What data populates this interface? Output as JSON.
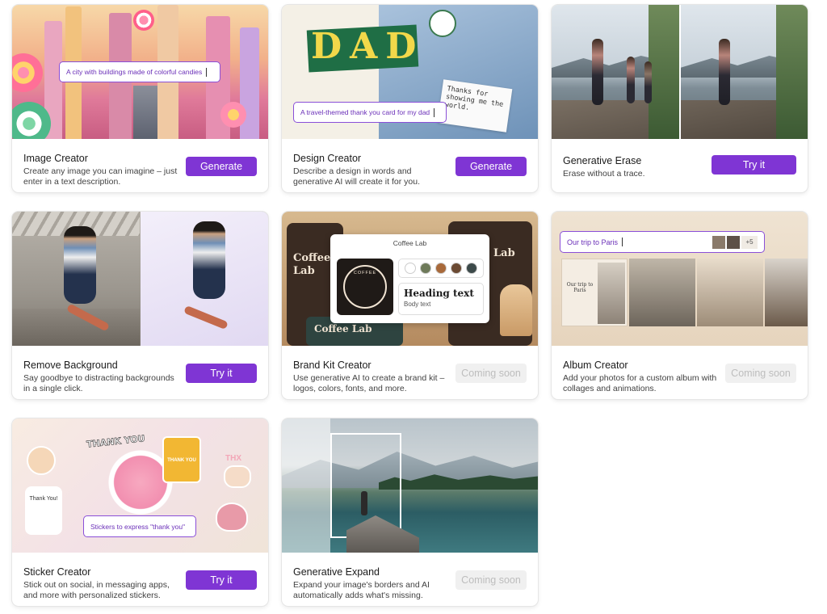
{
  "cards": [
    {
      "title": "Image Creator",
      "description": "Create any image you can imagine – just enter in a text description.",
      "action": "Generate",
      "prompt": "A city with buildings made of colorful candies"
    },
    {
      "title": "Design Creator",
      "description": "Describe a design in words and generative AI will create it for you.",
      "action": "Generate",
      "prompt": "A travel-themed thank you card for my dad",
      "art_word": "DAD",
      "note_text": "Thanks for showing me the world."
    },
    {
      "title": "Generative Erase",
      "description": "Erase without a trace.",
      "action": "Try it"
    },
    {
      "title": "Remove Background",
      "description": "Say goodbye to distracting backgrounds in a single click.",
      "action": "Try it"
    },
    {
      "title": "Brand Kit Creator",
      "description": "Use generative AI to create a brand kit – logos, colors, fonts, and more.",
      "action": "Coming soon",
      "panel_title": "Coffee Lab",
      "heading_sample": "Heading text",
      "body_sample": "Body text",
      "bg_text_left": "Coffee Lab",
      "bg_text_bottom": "Coffee Lab",
      "bg_text_right": "Lab",
      "logo_text": "COFFEE",
      "swatches": [
        "#ffffff",
        "#6e7a5a",
        "#a8693a",
        "#6b4a33",
        "#3c4a4a"
      ]
    },
    {
      "title": "Album Creator",
      "description": "Add your photos for a custom album with collages and animations.",
      "action": "Coming soon",
      "prompt": "Our trip to Paris",
      "photo_count": "+5",
      "album_caption": "Our trip to Paris"
    },
    {
      "title": "Sticker Creator",
      "description": "Stick out on social, in messaging apps, and more with personalized stickers.",
      "action": "Try it",
      "prompt": "Stickers to express \"thank you\"",
      "sticker_text_top": "THANK YOU",
      "sticker_text_left": "Thank You!",
      "sticker_text_right": "THX",
      "sticker_text_beer": "THANK YOU"
    },
    {
      "title": "Generative Expand",
      "description": "Expand your image's borders and AI automatically adds what's missing.",
      "action": "Coming soon"
    }
  ],
  "colors": {
    "accent": "#7f35d4",
    "disabled_bg": "#f0f0f0",
    "disabled_text": "#bdbdbd"
  }
}
